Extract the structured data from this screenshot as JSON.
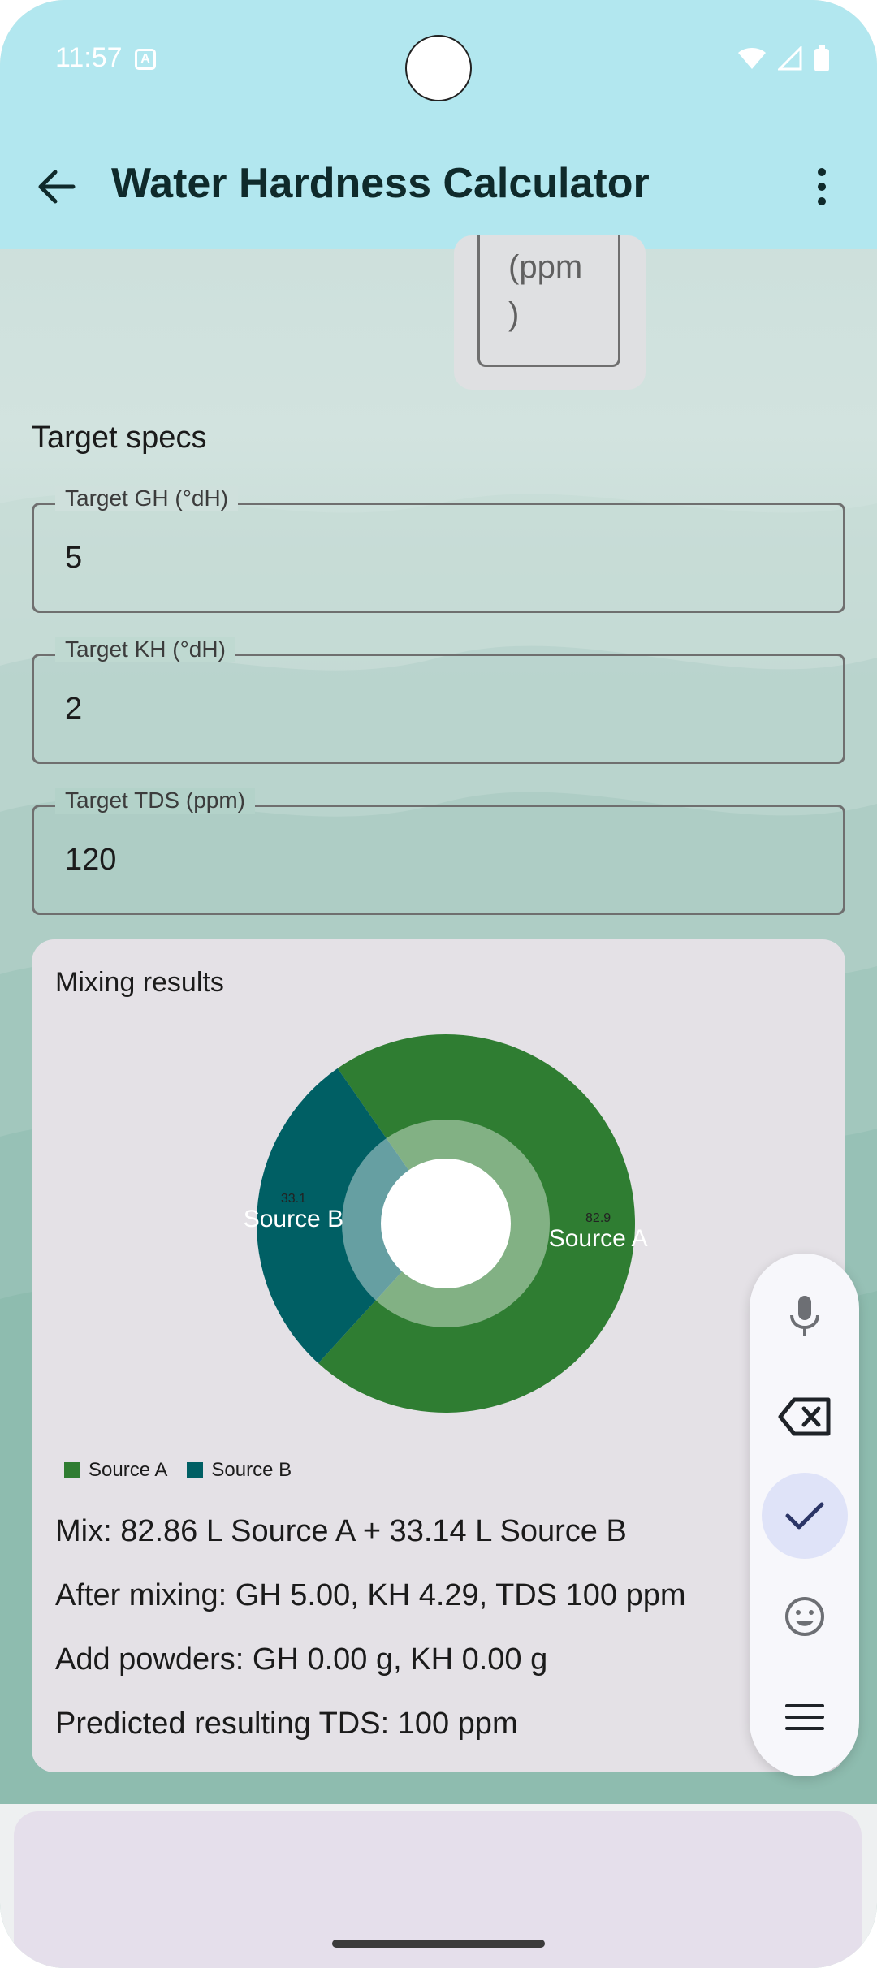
{
  "status_bar": {
    "time": "11:57",
    "notification_icon": "a-icon"
  },
  "app_bar": {
    "title": "Water Hardness Calculator"
  },
  "partial_field": {
    "text": "(ppm\n)"
  },
  "target_specs": {
    "title": "Target specs",
    "fields": [
      {
        "label": "Target GH (°dH)",
        "value": "5"
      },
      {
        "label": "Target KH (°dH)",
        "value": "2"
      },
      {
        "label": "Target TDS (ppm)",
        "value": "120"
      }
    ]
  },
  "results": {
    "title": "Mixing results",
    "lines": [
      "Mix: 82.86 L Source A + 33.14 L Source B",
      "After mixing: GH 5.00, KH 4.29, TDS 100 ppm",
      "Add powders: GH 0.00 g, KH 0.00 g",
      "Predicted resulting TDS: 100 ppm"
    ]
  },
  "chart_data": {
    "type": "pie",
    "categories": [
      "Source A",
      "Source B"
    ],
    "values": [
      82.9,
      33.1
    ],
    "value_labels": [
      "82.9",
      "33.1"
    ],
    "colors": [
      "#2f7d32",
      "#005f64"
    ],
    "legend": [
      "Source A",
      "Source B"
    ],
    "legend_position": "bottom-left",
    "hole": true
  },
  "floating_toolbar": {
    "items": [
      "microphone-icon",
      "backspace-icon",
      "check-icon",
      "emoji-icon",
      "menu-icon"
    ]
  },
  "colors": {
    "app_bar": "#b2e7ef",
    "card": "#e4e1e6",
    "accent": "#dfe3f8"
  }
}
